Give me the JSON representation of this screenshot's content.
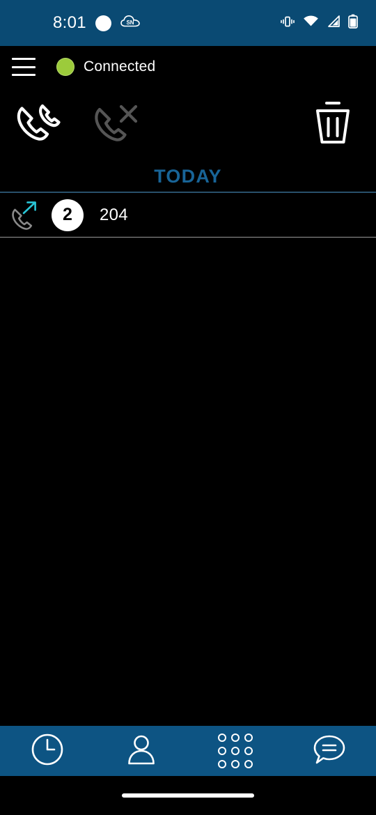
{
  "status_bar": {
    "time": "8:01",
    "background_color": "#0a4a73",
    "left_icons": [
      {
        "name": "notification-dot-icon",
        "label": "notification-dot"
      },
      {
        "name": "cloud-sn-icon",
        "label": "cloud-sn",
        "text": "SN"
      }
    ],
    "right_icons": [
      {
        "name": "vibrate-icon",
        "label": "vibrate"
      },
      {
        "name": "wifi-icon",
        "label": "wifi"
      },
      {
        "name": "cellular-signal-icon",
        "label": "cellular-signal"
      },
      {
        "name": "battery-icon",
        "label": "battery"
      }
    ]
  },
  "app_header": {
    "menu_icon": "hamburger-menu-icon",
    "status_dot_color": "#9ccb3b",
    "status_label": "Connected"
  },
  "toolbar": {
    "filters": [
      {
        "name": "all-calls-filter",
        "icon": "phone-calls-icon",
        "label": "All calls",
        "active": true
      },
      {
        "name": "missed-calls-filter",
        "icon": "missed-call-icon",
        "label": "Missed calls",
        "active": false
      }
    ],
    "delete": {
      "name": "delete-button",
      "icon": "trash-icon",
      "label": "Delete"
    }
  },
  "call_log": {
    "sections": [
      {
        "title": "TODAY",
        "title_color": "#186497",
        "rows": [
          {
            "direction_icon": "outgoing-call-icon",
            "direction": "outgoing",
            "count": "2",
            "number": "204"
          }
        ]
      }
    ]
  },
  "bottom_nav": {
    "background_color": "#0d5483",
    "tabs": [
      {
        "name": "tab-recents",
        "icon": "clock-icon",
        "label": "Recents",
        "active": true
      },
      {
        "name": "tab-contacts",
        "icon": "person-icon",
        "label": "Contacts",
        "active": false
      },
      {
        "name": "tab-dialpad",
        "icon": "dialpad-icon",
        "label": "Dialpad",
        "active": false
      },
      {
        "name": "tab-messages",
        "icon": "message-bubble-icon",
        "label": "Messages",
        "active": false
      }
    ]
  },
  "gesture_bar": {
    "label": "home-indicator"
  }
}
